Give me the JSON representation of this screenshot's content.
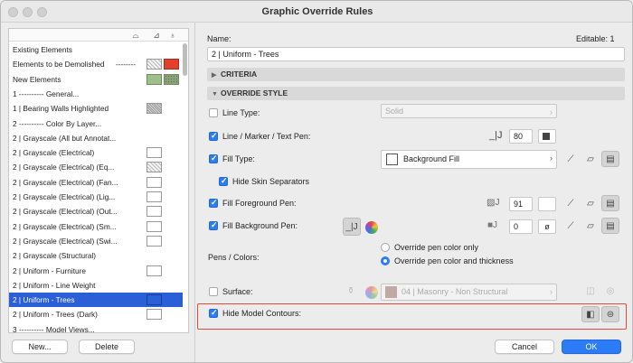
{
  "window": {
    "title": "Graphic Override Rules"
  },
  "left_list": {
    "header_icons": [
      "cut-fill-icon",
      "pen-icon",
      "marker-icon"
    ],
    "rows": [
      {
        "label": "Existing Elements",
        "swatches": []
      },
      {
        "label": "Elements to be Demolished",
        "dashes": "--------",
        "swatches": [
          "hatch",
          "red"
        ]
      },
      {
        "label": "New Elements",
        "swatches": [
          "green",
          "dots"
        ]
      },
      {
        "label": "1 ----------        General...",
        "swatches": []
      },
      {
        "label": "1 | Bearing Walls Highlighted",
        "swatches": [
          "hatch2"
        ]
      },
      {
        "label": "2 ----------  Color By Layer...",
        "swatches": []
      },
      {
        "label": "2 | Grayscale (All but Annotat...",
        "swatches": []
      },
      {
        "label": "2 | Grayscale (Electrical)",
        "swatches": [
          "plain"
        ]
      },
      {
        "label": "2 | Grayscale (Electrical) (Eq...",
        "swatches": [
          "hatch"
        ]
      },
      {
        "label": "2 | Grayscale (Electrical) (Fan...",
        "swatches": [
          "plain"
        ]
      },
      {
        "label": "2 | Grayscale (Electrical) (Lig...",
        "swatches": [
          "plain"
        ]
      },
      {
        "label": "2 | Grayscale (Electrical) (Out...",
        "swatches": [
          "plain"
        ]
      },
      {
        "label": "2 | Grayscale (Electrical) (Sm...",
        "swatches": [
          "plain"
        ]
      },
      {
        "label": "2 | Grayscale (Electrical) (Swi...",
        "swatches": [
          "plain"
        ]
      },
      {
        "label": "2 | Grayscale (Structural)",
        "swatches": []
      },
      {
        "label": "2 | Uniform - Furniture",
        "swatches": [
          "plain"
        ]
      },
      {
        "label": "2 | Uniform - Line Weight",
        "swatches": []
      },
      {
        "label": "2 | Uniform - Trees",
        "swatches": [
          "blue"
        ],
        "selected": true
      },
      {
        "label": "2 | Uniform - Trees (Dark)",
        "swatches": [
          "plain"
        ]
      },
      {
        "label": "3 ----------   Model Views...",
        "swatches": []
      }
    ],
    "new_button": "New...",
    "delete_button": "Delete"
  },
  "detail": {
    "name_label": "Name:",
    "editable_label": "Editable: 1",
    "name_value": "2 | Uniform - Trees",
    "criteria_section": "CRITERIA",
    "override_section": "OVERRIDE STYLE",
    "line_type": {
      "label": "Line Type:",
      "checked": false,
      "value": "Solid"
    },
    "line_pen": {
      "label": "Line / Marker / Text Pen:",
      "checked": true,
      "pen": "80"
    },
    "fill_type": {
      "label": "Fill Type:",
      "checked": true,
      "value": "Background Fill"
    },
    "hide_skin": {
      "label": "Hide Skin Separators",
      "checked": true
    },
    "fill_fg": {
      "label": "Fill Foreground Pen:",
      "checked": true,
      "pen": "91"
    },
    "fill_bg": {
      "label": "Fill Background Pen:",
      "checked": true,
      "pen": "0",
      "empty_symbol": "ø"
    },
    "pens_colors": {
      "label": "Pens / Colors:",
      "option1": "Override pen color only",
      "option2": "Override pen color and thickness",
      "selected": 2
    },
    "surface": {
      "label": "Surface:",
      "checked": false,
      "value": "04 | Masonry - Non Structural"
    },
    "hide_contours": {
      "label": "Hide Model Contours:",
      "checked": true
    }
  },
  "footer": {
    "cancel_button": "Cancel",
    "ok_button": "OK"
  },
  "colors": {
    "accent": "#2b7cf6",
    "selection": "#2b5fd8",
    "highlight_border": "#e24a3b"
  }
}
